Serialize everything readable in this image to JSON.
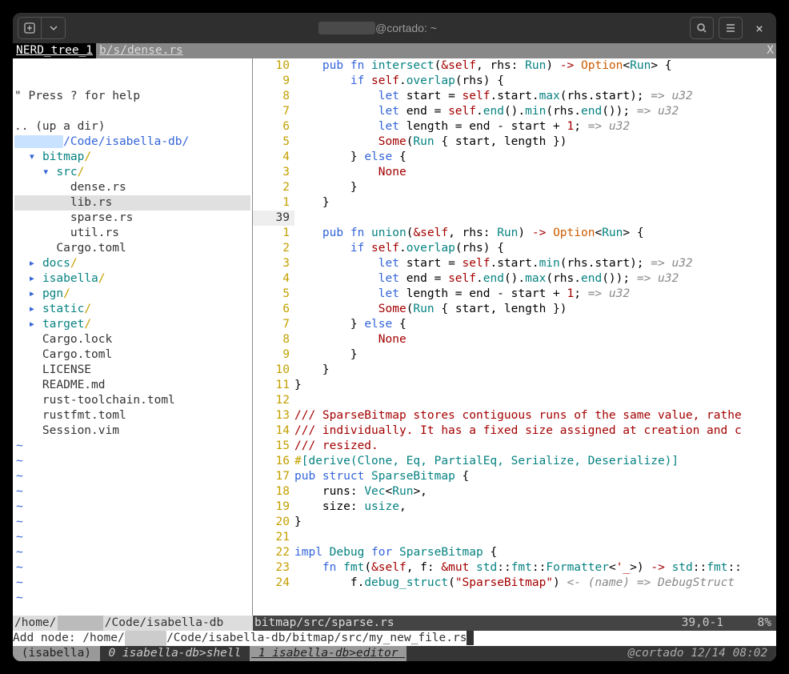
{
  "titlebar": {
    "title_host": "@cortado: ~"
  },
  "tabs": {
    "nerd": " NERD_tree_1 ",
    "file": "b/s/dense.rs",
    "x": "X"
  },
  "tree": {
    "help": "\" Press ? for help",
    "up": ".. (up a dir)",
    "root_pre": "</",
    "root_post": "/Code/isabella-db/",
    "items": [
      {
        "indent": "  ",
        "arrow": "▾ ",
        "name": "bitmap",
        "slash": "/",
        "blue": true
      },
      {
        "indent": "    ",
        "arrow": "▾ ",
        "name": "src",
        "slash": "/",
        "blue": true
      },
      {
        "indent": "        ",
        "arrow": "",
        "name": "dense.rs"
      },
      {
        "indent": "        ",
        "arrow": "",
        "name": "lib.rs",
        "sel": true
      },
      {
        "indent": "        ",
        "arrow": "",
        "name": "sparse.rs"
      },
      {
        "indent": "        ",
        "arrow": "",
        "name": "util.rs"
      },
      {
        "indent": "      ",
        "arrow": "",
        "name": "Cargo.toml"
      },
      {
        "indent": "  ",
        "arrow": "▸ ",
        "name": "docs",
        "slash": "/",
        "blue": true
      },
      {
        "indent": "  ",
        "arrow": "▸ ",
        "name": "isabella",
        "slash": "/",
        "blue": true
      },
      {
        "indent": "  ",
        "arrow": "▸ ",
        "name": "pgn",
        "slash": "/",
        "blue": true
      },
      {
        "indent": "  ",
        "arrow": "▸ ",
        "name": "static",
        "slash": "/",
        "blue": true
      },
      {
        "indent": "  ",
        "arrow": "▸ ",
        "name": "target",
        "slash": "/",
        "blue": true
      },
      {
        "indent": "    ",
        "arrow": "",
        "name": "Cargo.lock"
      },
      {
        "indent": "    ",
        "arrow": "",
        "name": "Cargo.toml"
      },
      {
        "indent": "    ",
        "arrow": "",
        "name": "LICENSE"
      },
      {
        "indent": "    ",
        "arrow": "",
        "name": "README.md"
      },
      {
        "indent": "    ",
        "arrow": "",
        "name": "rust-toolchain.toml"
      },
      {
        "indent": "    ",
        "arrow": "",
        "name": "rustfmt.toml"
      },
      {
        "indent": "    ",
        "arrow": "",
        "name": "Session.vim"
      }
    ]
  },
  "gutter": [
    "10",
    "9",
    "8",
    "7",
    "6",
    "5",
    "4",
    "3",
    "2",
    "1",
    "39",
    "1",
    "2",
    "3",
    "4",
    "5",
    "6",
    "7",
    "8",
    "9",
    "10",
    "11",
    "12",
    "13",
    "14",
    "15",
    "16",
    "17",
    "18",
    "19",
    "20",
    "21",
    "22",
    "23",
    "24"
  ],
  "gutter_abs_index": 10,
  "code": [
    "    <kw>pub fn</kw> <fnname>intersect</fnname>(<amp>&</amp><self>self</self>, rhs: <ty>Run</ty>) <arrow>-></arrow> <orange>Option</orange><<ty>Run</ty>> {",
    "        <kw>if</kw> <self>self</self>.<fnname>overlap</fnname>(rhs) {",
    "            <kw>let</kw> start = <self>self</self>.start.<fnname>max</fnname>(rhs.start); <hint>=> u32</hint>",
    "            <kw>let</kw> end = <self>self</self>.<fnname>end</fnname>().<fnname>min</fnname>(rhs.<fnname>end</fnname>()); <hint>=> u32</hint>",
    "            <kw>let</kw> length = end - start + <num>1</num>; <hint>=> u32</hint>",
    "            <self>Some</self>(<ty>Run</ty> { start, length })",
    "        } <kw>else</kw> {",
    "            <self>None</self>",
    "        }",
    "    }",
    "",
    "    <kw>pub fn</kw> <fnname>union</fnname>(<amp>&</amp><self>self</self>, rhs: <ty>Run</ty>) <arrow>-></arrow> <orange>Option</orange><<ty>Run</ty>> {",
    "        <kw>if</kw> <self>self</self>.<fnname>overlap</fnname>(rhs) {",
    "            <kw>let</kw> start = <self>self</self>.start.<fnname>min</fnname>(rhs.start); <hint>=> u32</hint>",
    "            <kw>let</kw> end = <self>self</self>.<fnname>end</fnname>().<fnname>max</fnname>(rhs.<fnname>end</fnname>()); <hint>=> u32</hint>",
    "            <kw>let</kw> length = end - start + <num>1</num>; <hint>=> u32</hint>",
    "            <self>Some</self>(<ty>Run</ty> { start, length })",
    "        } <kw>else</kw> {",
    "            <self>None</self>",
    "        }",
    "    }",
    "}",
    "",
    "<doc>/// SparseBitmap stores contiguous runs of the same value, rathe</doc>",
    "<doc>/// individually. It has a fixed size assigned at creation and c</doc>",
    "<doc>/// resized.</doc>",
    "<pname>#</pname><attr>[derive(Clone, Eq, PartialEq, Serialize, Deserialize)]</attr>",
    "<kw>pub struct</kw> <ty>SparseBitmap</ty> {",
    "    runs: <ty>Vec</ty><<ty>Run</ty>>,",
    "    size: <ty>usize</ty>,",
    "}",
    "",
    "<kw>impl</kw> <ty>Debug</ty> <kw>for</kw> <ty>SparseBitmap</ty> {",
    "    <kw>fn</kw> <fnname>fmt</fnname>(<amp>&</amp><self>self</self>, f: <amp>&mut</amp> <ty>std</ty>::<ty>fmt</ty>::<ty>Formatter</ty><<str>'_</str>>) <arrow>-></arrow> <ty>std</ty>::<ty>fmt</ty>::",
    "        f.<fnname>debug_struct</fnname>(<str>\"SparseBitmap\"</str>) <hint><- (name)</hint> <hint>=> DebugStruct</hint>"
  ],
  "status_left": {
    "pre": "/home/",
    "post": "/Code/isabella-db"
  },
  "status_right": {
    "path": "bitmap/src/sparse.rs",
    "pos": "39,0-1",
    "pct": "8%"
  },
  "cmdline": {
    "pre": "Add node: /home/",
    "post": "/Code/isabella-db/bitmap/src/my_new_file.rs"
  },
  "tmux": {
    "session": " (isabella) ",
    "win0": " 0 isabella-db>shell ",
    "win1": " 1 isabella-db>editor ",
    "right": "@cortado 12/14 08:02 "
  }
}
